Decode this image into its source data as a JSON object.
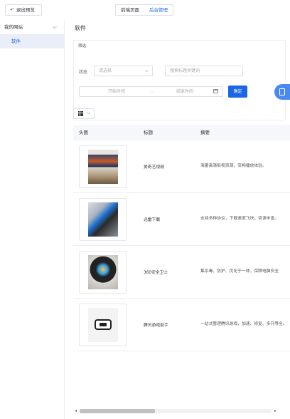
{
  "topbar": {
    "exit_label": "退出预览",
    "tabs": [
      "前端页面",
      "后台管理"
    ],
    "active_tab": "后台管理"
  },
  "sidebar": {
    "group_label": "我的网站",
    "items": [
      {
        "label": "软件",
        "active": true
      }
    ]
  },
  "main": {
    "section_title": "软件",
    "filter": {
      "heading": "筛选",
      "status_label": "状态",
      "status_placeholder": "请选择",
      "keyword_placeholder": "搜索标题关键词",
      "start_placeholder": "开始时间",
      "separator": "-",
      "end_placeholder": "结束时间",
      "confirm_label": "确定"
    },
    "table": {
      "columns": [
        "头图",
        "标题",
        "摘要"
      ],
      "rows": [
        {
          "image": "smart-tv-living-room",
          "title": "爱奇艺视频",
          "summary": "海量高清影视资源，流畅播放体验。"
        },
        {
          "image": "5g-download",
          "title": "迅雷下载",
          "summary": "支持多种协议，下载速度飞快，资源丰富。"
        },
        {
          "image": "360-security",
          "title": "360安全卫士",
          "summary": "集杀毒、防护、优化于一体，保障电脑安全"
        },
        {
          "image": "handheld-game-console",
          "title": "腾讯游戏助手",
          "summary": "一站式管理腾讯游戏，加速、修复、多开等全。"
        }
      ]
    }
  },
  "colors": {
    "accent": "#1a66e6",
    "float_tab": "#4a8af0"
  },
  "icons": {
    "exit": "undo-arrow-icon",
    "chevron": "chevron-down-icon",
    "calendar": "calendar-icon",
    "grid": "grid-icon",
    "float": "document-icon"
  }
}
